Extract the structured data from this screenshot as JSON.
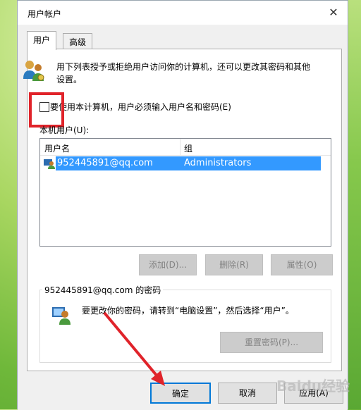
{
  "window": {
    "title": "用户帐户",
    "close_glyph": "✕"
  },
  "tabs": [
    {
      "label": "用户"
    },
    {
      "label": "高级"
    }
  ],
  "description": "用下列表授予或拒绝用户访问你的计算机，还可以更改其密码和其他设置。",
  "checkbox": {
    "label": "要使用本计算机，用户必须输入用户名和密码(E)",
    "checked": false
  },
  "users": {
    "label": "本机用户(U):",
    "columns": [
      "用户名",
      "组"
    ],
    "rows": [
      {
        "username": "952445891@qq.com",
        "group": "Administrators"
      }
    ]
  },
  "list_buttons": {
    "add": "添加(D)...",
    "remove": "删除(R)",
    "properties": "属性(O)"
  },
  "password_group": {
    "label": "952445891@qq.com 的密码",
    "text": "要更改你的密码，请转到“电脑设置”，然后选择“用户”。",
    "reset_button": "重置密码(P)..."
  },
  "footer_buttons": {
    "ok": "确定",
    "cancel": "取消",
    "apply": "应用(A)"
  },
  "watermark": "Baidu经验",
  "colors": {
    "selection": "#3399ff",
    "annotation_red": "#e0232a",
    "primary_border": "#0078d7"
  }
}
